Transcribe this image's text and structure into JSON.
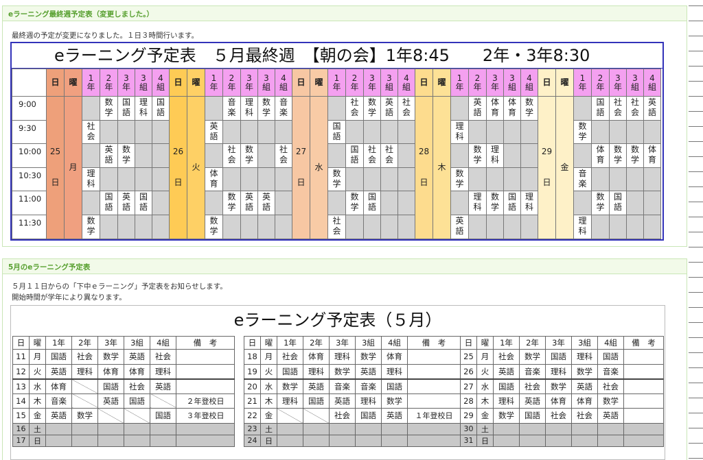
{
  "section1": {
    "title": "eラーニング最終週予定表（変更しました。）",
    "note": "最終週の予定が変更になりました。１日３時間行います。",
    "table_title": "eラーニング予定表　５月最終週　【朝の会】1年8:45　　2年・3年8:30",
    "header": {
      "day": "日",
      "weekday": "曜",
      "classes": [
        "1年",
        "2年",
        "3年",
        "3組",
        "4組"
      ]
    },
    "times": [
      "9:00",
      "9:30",
      "10:00",
      "10:30",
      "11:00",
      "11:30"
    ],
    "days": [
      {
        "date": "25",
        "unit": "日",
        "weekday": "月",
        "date_color": "#eea07a",
        "wd_color": "#f0a080",
        "cells": [
          [
            "",
            "数学",
            "国語",
            "理科",
            "国語"
          ],
          [
            "社会",
            "",
            "",
            "",
            ""
          ],
          [
            "",
            "英語",
            "数学",
            "",
            ""
          ],
          [
            "理科",
            "",
            "",
            "",
            ""
          ],
          [
            "",
            "国語",
            "英語",
            "国語",
            ""
          ],
          [
            "数学",
            "",
            "",
            "",
            ""
          ]
        ]
      },
      {
        "date": "26",
        "unit": "日",
        "weekday": "火",
        "date_color": "#fecb55",
        "wd_color": "#fed065",
        "cells": [
          [
            "",
            "音楽",
            "理科",
            "数学",
            "音楽"
          ],
          [
            "英語",
            "",
            "",
            "",
            ""
          ],
          [
            "",
            "社会",
            "数学",
            "",
            "社会"
          ],
          [
            "体育",
            "",
            "",
            "",
            ""
          ],
          [
            "",
            "数学",
            "英語",
            "英語",
            ""
          ],
          [
            "数学",
            "",
            "",
            "",
            ""
          ]
        ]
      },
      {
        "date": "27",
        "unit": "日",
        "weekday": "水",
        "date_color": "#f7c7a3",
        "wd_color": "#f8cba6",
        "cells": [
          [
            "",
            "社会",
            "数学",
            "英語",
            "社会"
          ],
          [
            "国語",
            "",
            "",
            "",
            ""
          ],
          [
            "",
            "国語",
            "社会",
            "社会",
            ""
          ],
          [
            "数学",
            "",
            "",
            "",
            ""
          ],
          [
            "",
            "数学",
            "国語",
            "",
            ""
          ],
          [
            "社会",
            "",
            "",
            "",
            ""
          ]
        ]
      },
      {
        "date": "28",
        "unit": "日",
        "weekday": "木",
        "date_color": "#fddc8e",
        "wd_color": "#fde196",
        "cells": [
          [
            "",
            "英語",
            "体育",
            "体育",
            "数学"
          ],
          [
            "理科",
            "",
            "",
            "",
            ""
          ],
          [
            "",
            "数学",
            "理科",
            "",
            ""
          ],
          [
            "数学",
            "",
            "",
            "",
            ""
          ],
          [
            "",
            "理科",
            "数学",
            "国語",
            "理科"
          ],
          [
            "英語",
            "",
            "",
            "",
            ""
          ]
        ]
      },
      {
        "date": "29",
        "unit": "日",
        "weekday": "金",
        "date_color": "#fef1c8",
        "wd_color": "#fef1c8",
        "cells": [
          [
            "",
            "国語",
            "社会",
            "社会",
            "英語"
          ],
          [
            "数学",
            "",
            "",
            "",
            ""
          ],
          [
            "",
            "体育",
            "数学",
            "数学",
            "体育"
          ],
          [
            "音楽",
            "",
            "",
            "",
            ""
          ],
          [
            "",
            "数学",
            "国語",
            "",
            ""
          ],
          [
            "理科",
            "",
            "",
            "",
            ""
          ]
        ]
      }
    ]
  },
  "section2": {
    "title": "5月のeラーニング予定表",
    "line1": "５月１１日からの「下中ｅラーニング」予定表をお知らせします。",
    "line2": "開始時間が学年により異なります。",
    "table_title": "eラーニング予定表（５月）",
    "headers": [
      "日",
      "曜",
      "1年",
      "2年",
      "3年",
      "3組",
      "4組",
      "備　考"
    ],
    "weeks": [
      [
        [
          "11",
          "月",
          "国語",
          "社会",
          "数学",
          "英語",
          "社会",
          ""
        ],
        [
          "12",
          "火",
          "英語",
          "理科",
          "体育",
          "体育",
          "理科",
          ""
        ],
        [
          "13",
          "水",
          "体育",
          "/",
          "国語",
          "社会",
          "英語",
          ""
        ],
        [
          "14",
          "木",
          "音楽",
          "/",
          "英語",
          "国語",
          "/",
          "２年登校日"
        ],
        [
          "15",
          "金",
          "英語",
          "数学",
          "/",
          "/",
          "国語",
          "３年登校日"
        ],
        [
          "16",
          "土",
          "",
          "",
          "",
          "",
          "",
          ""
        ],
        [
          "17",
          "日",
          "",
          "",
          "",
          "",
          "",
          ""
        ]
      ],
      [
        [
          "18",
          "月",
          "社会",
          "体育",
          "理科",
          "数学",
          "体育",
          ""
        ],
        [
          "19",
          "火",
          "国語",
          "理科",
          "数学",
          "英語",
          "理科",
          ""
        ],
        [
          "20",
          "水",
          "数学",
          "英語",
          "音楽",
          "音楽",
          "国語",
          ""
        ],
        [
          "21",
          "木",
          "理科",
          "国語",
          "英語",
          "理科",
          "数学",
          ""
        ],
        [
          "22",
          "金",
          "/",
          "/",
          "社会",
          "国語",
          "英語",
          "１年登校日"
        ],
        [
          "23",
          "土",
          "",
          "",
          "",
          "",
          "",
          ""
        ],
        [
          "24",
          "日",
          "",
          "",
          "",
          "",
          "",
          ""
        ]
      ],
      [
        [
          "25",
          "月",
          "社会",
          "数学",
          "国語",
          "理科",
          "国語",
          ""
        ],
        [
          "26",
          "火",
          "英語",
          "音楽",
          "理科",
          "数学",
          "音楽",
          ""
        ],
        [
          "27",
          "水",
          "国語",
          "社会",
          "数学",
          "英語",
          "社会",
          ""
        ],
        [
          "28",
          "木",
          "理科",
          "英語",
          "体育",
          "体育",
          "数学",
          ""
        ],
        [
          "29",
          "金",
          "数学",
          "国語",
          "社会",
          "社会",
          "英語",
          ""
        ],
        [
          "30",
          "土",
          "",
          "",
          "",
          "",
          "",
          ""
        ],
        [
          "31",
          "日",
          "",
          "",
          "",
          "",
          "",
          ""
        ]
      ]
    ]
  }
}
